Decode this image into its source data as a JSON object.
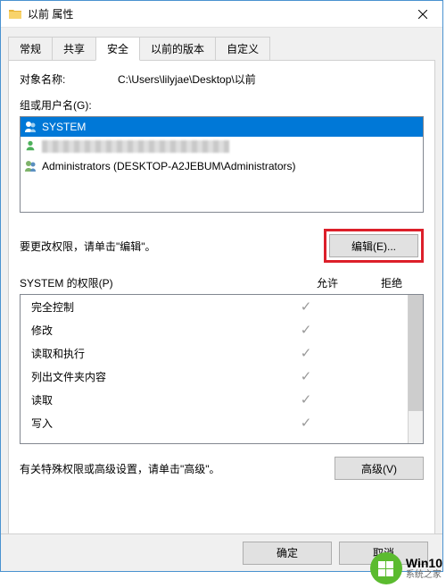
{
  "window": {
    "title": "以前 属性"
  },
  "tabs": {
    "general": "常规",
    "sharing": "共享",
    "security": "安全",
    "previous": "以前的版本",
    "custom": "自定义"
  },
  "object": {
    "label": "对象名称:",
    "path": "C:\\Users\\lilyjae\\Desktop\\以前"
  },
  "groups": {
    "label": "组或用户名(G):",
    "items": [
      {
        "name": "SYSTEM"
      },
      {
        "name": ""
      },
      {
        "name": "Administrators (DESKTOP-A2JEBUM\\Administrators)"
      }
    ]
  },
  "edit": {
    "hint": "要更改权限，请单击\"编辑\"。",
    "button": "编辑(E)..."
  },
  "permissions": {
    "label": "SYSTEM 的权限(P)",
    "allow": "允许",
    "deny": "拒绝",
    "items": [
      {
        "name": "完全控制",
        "allow": true,
        "deny": false
      },
      {
        "name": "修改",
        "allow": true,
        "deny": false
      },
      {
        "name": "读取和执行",
        "allow": true,
        "deny": false
      },
      {
        "name": "列出文件夹内容",
        "allow": true,
        "deny": false
      },
      {
        "name": "读取",
        "allow": true,
        "deny": false
      },
      {
        "name": "写入",
        "allow": true,
        "deny": false
      }
    ]
  },
  "advanced": {
    "hint": "有关特殊权限或高级设置，请单击\"高级\"。",
    "button": "高级(V)"
  },
  "footer": {
    "ok": "确定",
    "cancel": "取消"
  },
  "watermark": {
    "line1": "Win10",
    "line2": "系统之家"
  }
}
